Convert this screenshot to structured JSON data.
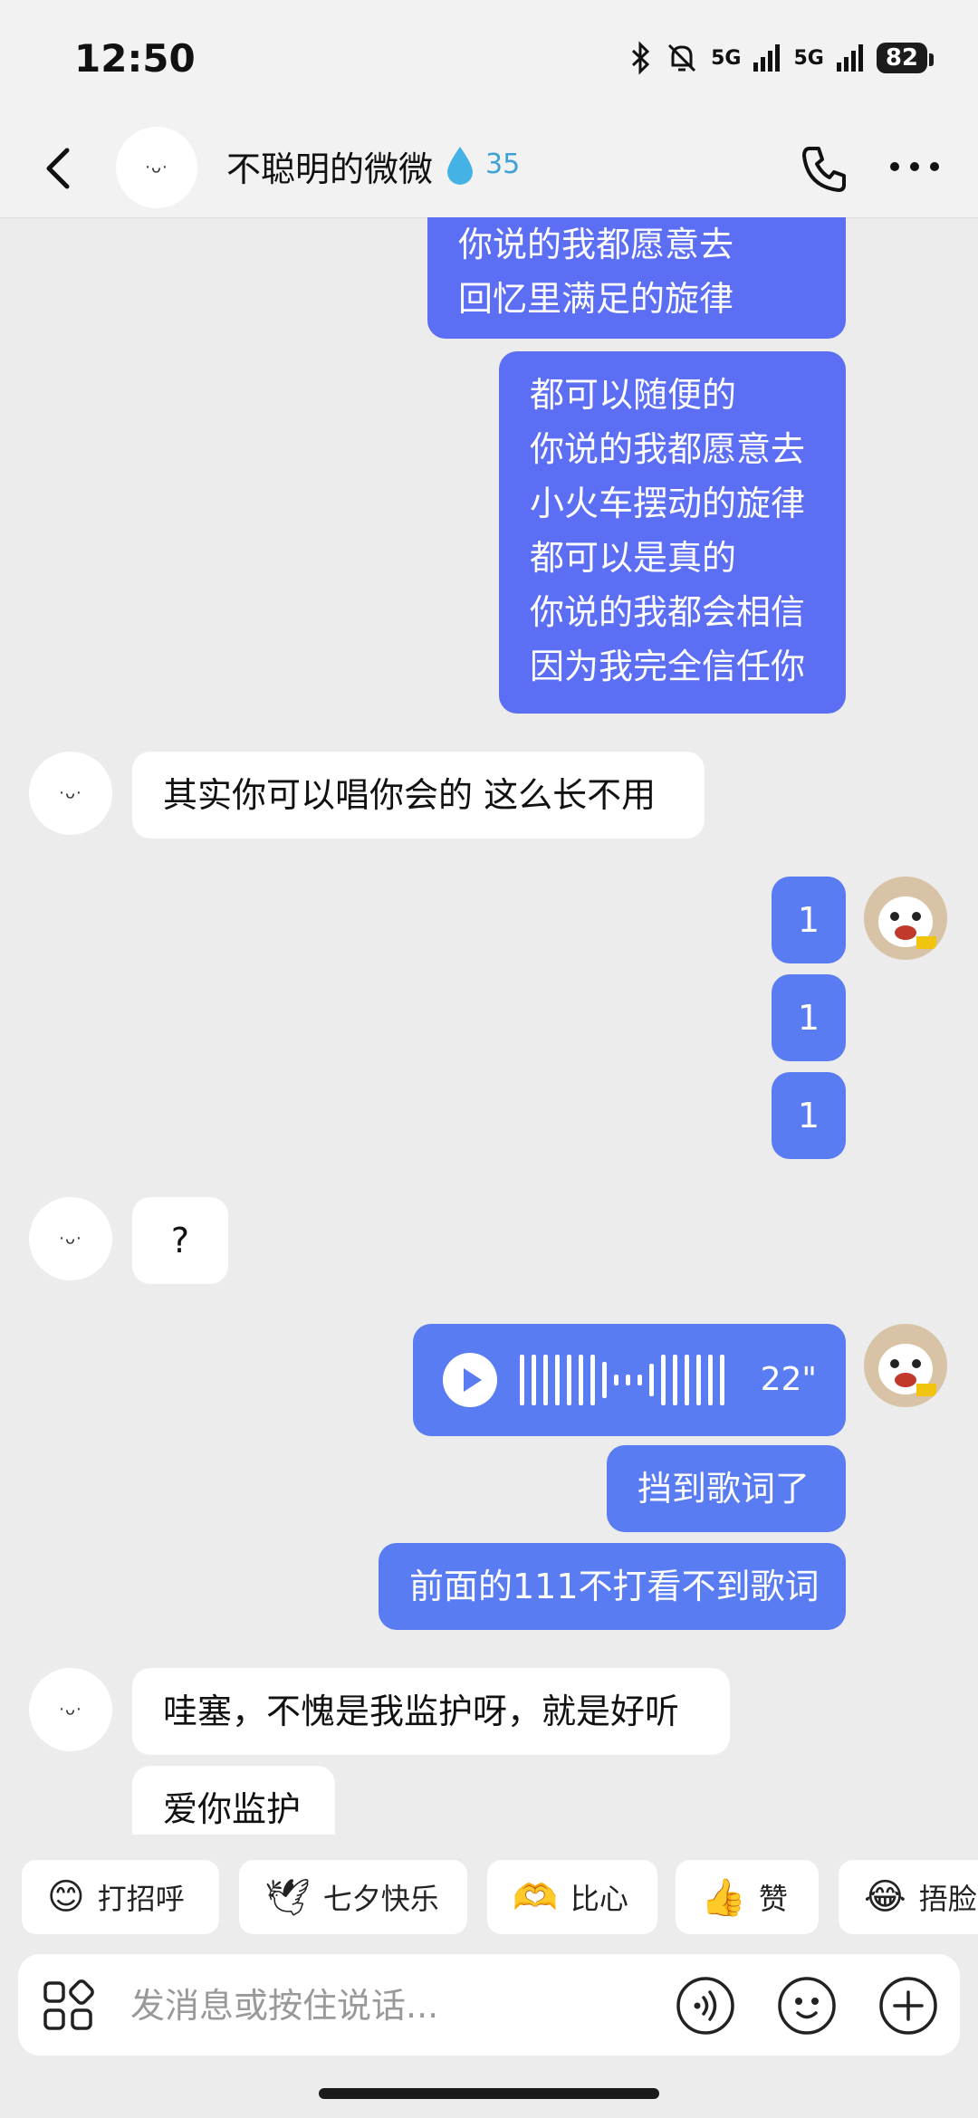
{
  "status": {
    "time": "12:50",
    "net1": "5G",
    "net2": "5G",
    "battery": "82"
  },
  "header": {
    "name": "不聪明的微微",
    "spark_count": "35",
    "avatar_face": "·ᴗ·"
  },
  "messages": {
    "m1": [
      "你说的我都愿意去",
      "回忆里满足的旋律"
    ],
    "m2": [
      "都可以随便的",
      "你说的我都愿意去",
      "小火车摆动的旋律",
      "都可以是真的",
      "你说的我都会相信",
      "因为我完全信任你"
    ],
    "m3": "其实你可以唱你会的 这么长不用",
    "m4": "1",
    "m5": "1",
    "m6": "1",
    "m7": "?",
    "voice_duration": "22\"",
    "m8": "挡到歌词了",
    "m9": "前面的111不打看不到歌词",
    "m10": "哇塞，不愧是我监护呀，就是好听",
    "m11": "爱你监护"
  },
  "quick_replies": [
    "打招呼",
    "七夕快乐",
    "比心",
    "赞",
    "捂脸"
  ],
  "input": {
    "placeholder": "发消息或按住说话..."
  },
  "icons": {
    "back": "chevron-left-icon",
    "spark": "water-drop-icon",
    "call": "phone-icon",
    "more": "more-dots-icon",
    "apps": "apps-grid-icon",
    "voice": "voice-wave-icon",
    "emoji": "emoji-icon",
    "add": "plus-circle-icon"
  }
}
